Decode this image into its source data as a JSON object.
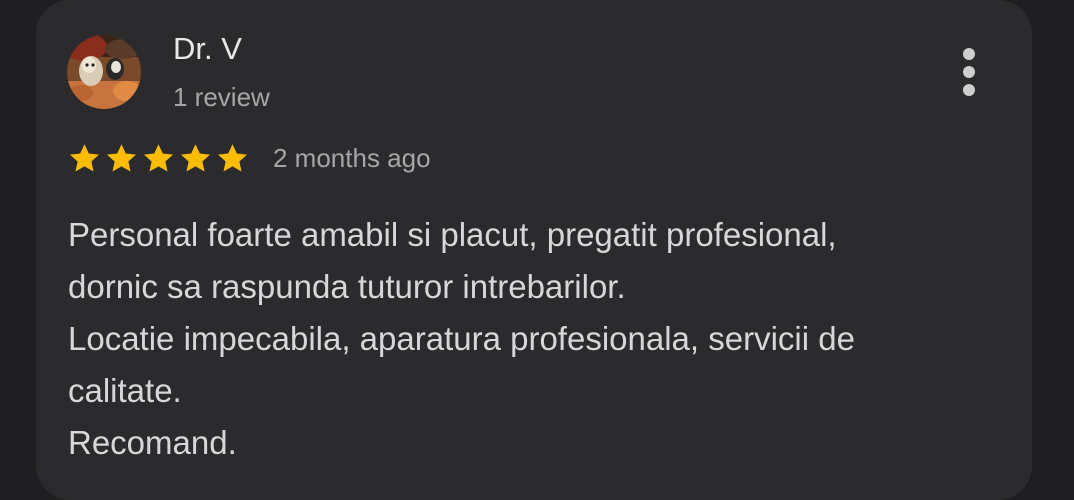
{
  "review": {
    "author_name": "Dr. V",
    "author_meta": "1 review",
    "rating": 5,
    "rating_max": 5,
    "date": "2 months ago",
    "text_lines": [
      "Personal foarte amabil si placut, pregatit profesional,",
      "dornic sa raspunda tuturor intrebarilor.",
      "Locatie impecabila, aparatura profesionala, servicii de",
      "calitate.",
      "Recomand."
    ],
    "more_icon": "more-vert-icon",
    "star_icon": "star-icon"
  },
  "colors": {
    "background": "#1f1f21",
    "card": "#2b2b2d",
    "star": "#fbbc04",
    "primary_text": "#e8e8e8",
    "secondary_text": "#a6a6a8",
    "body_text": "#d7d7d9"
  }
}
